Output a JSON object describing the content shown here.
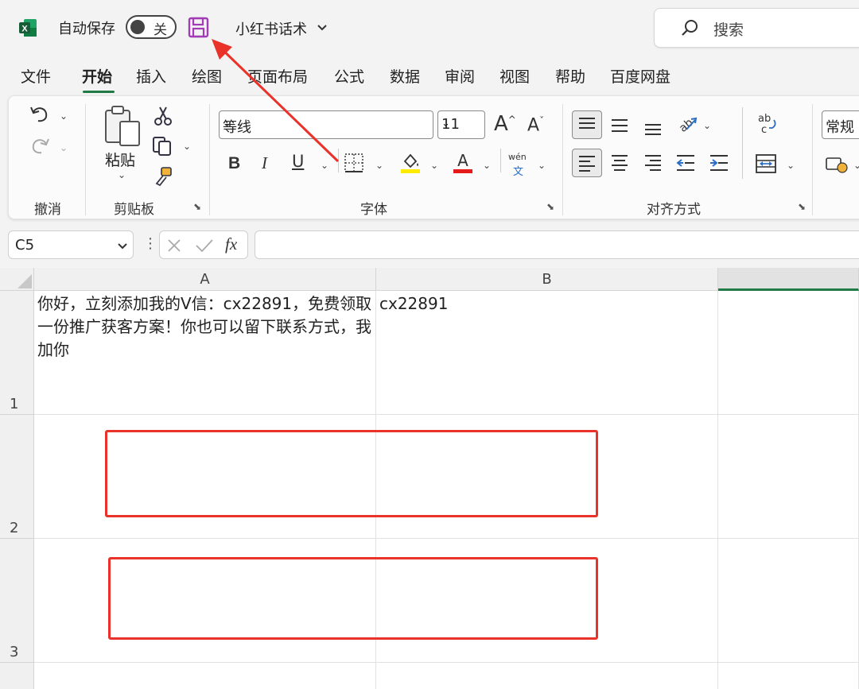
{
  "titlebar": {
    "autosave_label": "自动保存",
    "toggle_state": "关",
    "doc_name": "小红书话术",
    "search_placeholder": "搜索"
  },
  "tabs": [
    {
      "label": "文件"
    },
    {
      "label": "开始",
      "active": true
    },
    {
      "label": "插入"
    },
    {
      "label": "绘图"
    },
    {
      "label": "页面布局"
    },
    {
      "label": "公式"
    },
    {
      "label": "数据"
    },
    {
      "label": "审阅"
    },
    {
      "label": "视图"
    },
    {
      "label": "帮助"
    },
    {
      "label": "百度网盘"
    }
  ],
  "ribbon": {
    "undo_group": "撤消",
    "clipboard_group": "剪贴板",
    "paste_label": "粘贴",
    "font_group": "字体",
    "font_name": "等线",
    "font_size": "11",
    "align_group": "对齐方式",
    "number_format": "常规",
    "phonetic_label": "wén",
    "phonetic_char": "文"
  },
  "formula_bar": {
    "name_box": "C5",
    "fx_label": "fx",
    "formula": ""
  },
  "sheet": {
    "columns": [
      "A",
      "B"
    ],
    "rows": [
      "1",
      "2",
      "3"
    ],
    "cells": {
      "A1": "你好，立刻添加我的V信：cx22891，免费领取一份推广获客方案！你也可以留下联系方式，我加你",
      "B1": "cx22891"
    }
  },
  "colors": {
    "accent": "#1f7a45",
    "annotation": "#e8322a",
    "save_icon": "#a23bb5"
  },
  "icons": [
    "excel-logo-icon",
    "save-icon",
    "chevron-down-icon",
    "search-icon",
    "undo-icon",
    "redo-icon",
    "paste-icon",
    "cut-icon",
    "copy-icon",
    "format-painter-icon",
    "bold-icon",
    "italic-icon",
    "underline-icon",
    "border-icon",
    "fill-color-icon",
    "font-color-icon",
    "grow-font-icon",
    "shrink-font-icon",
    "align-top-icon",
    "align-middle-icon",
    "align-bottom-icon",
    "orientation-icon",
    "wrap-text-icon",
    "align-left-icon",
    "align-center-icon",
    "align-right-icon",
    "decrease-indent-icon",
    "increase-indent-icon",
    "merge-icon",
    "cancel-icon",
    "enter-icon"
  ]
}
